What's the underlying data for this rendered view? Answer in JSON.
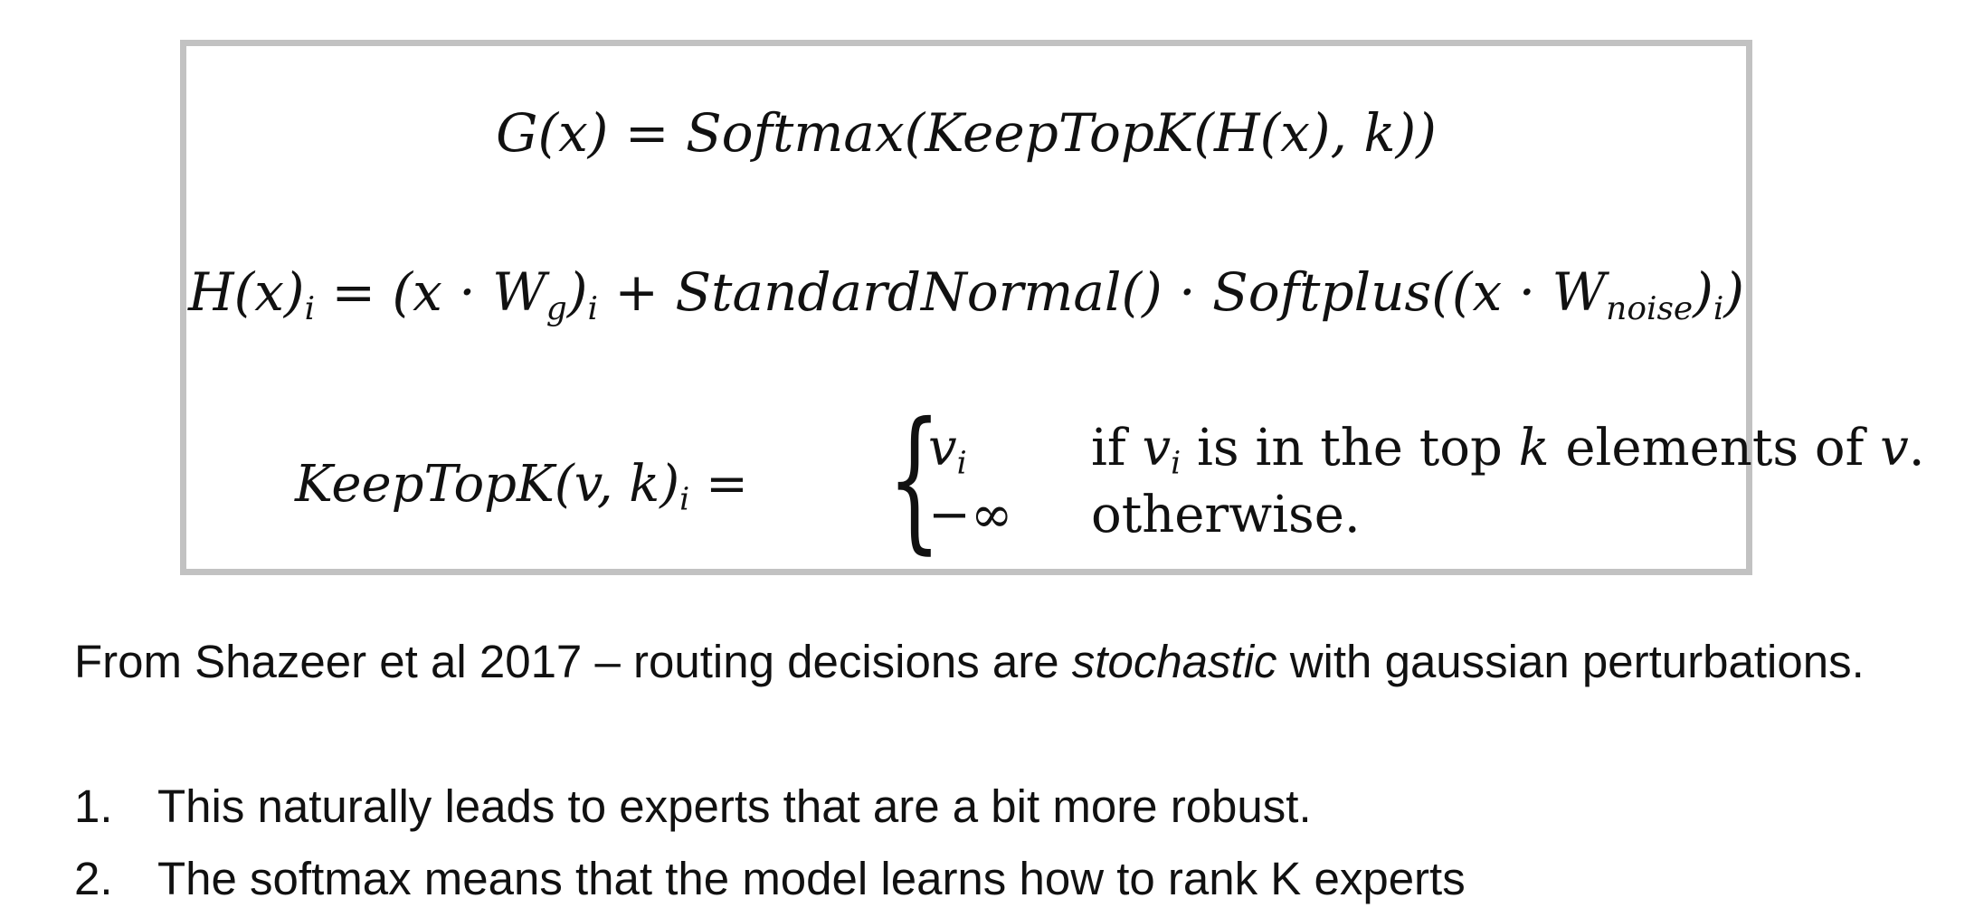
{
  "equations": {
    "gating": {
      "lhs": "G(x)",
      "eq": " = ",
      "rhs": "Softmax(KeepTopK(H(x), k))"
    },
    "noisy": {
      "h": "H(x)",
      "i1": "i",
      "eq": " = (x · W",
      "g": "g",
      "close1": ")",
      "i2": "i",
      "mid": " + StandardNormal() · Softplus((x · W",
      "noise": "noise",
      "close2": ")",
      "i3": "i",
      "end": ")"
    },
    "keeptopk": {
      "lhs": "KeepTopK(v, k)",
      "lhs_sub": "i",
      "eq": " = ",
      "case1_val": "v",
      "case1_val_sub": "i",
      "case1_cond_a": "if ",
      "case1_cond_v": "v",
      "case1_cond_sub": "i",
      "case1_cond_b": " is in the top ",
      "case1_cond_k": "k",
      "case1_cond_c": " elements of ",
      "case1_cond_v2": "v",
      "case1_cond_d": ".",
      "case2_val": "−∞",
      "case2_cond": "otherwise."
    }
  },
  "caption": {
    "before": "From Shazeer et al 2017 – routing decisions are ",
    "emph": "stochastic",
    "after": " with gaussian perturbations."
  },
  "list": [
    {
      "num": "1.",
      "text": "This naturally leads to experts that are a bit more robust."
    },
    {
      "num": "2.",
      "text": "The softmax means that the model learns how to rank K experts"
    }
  ]
}
